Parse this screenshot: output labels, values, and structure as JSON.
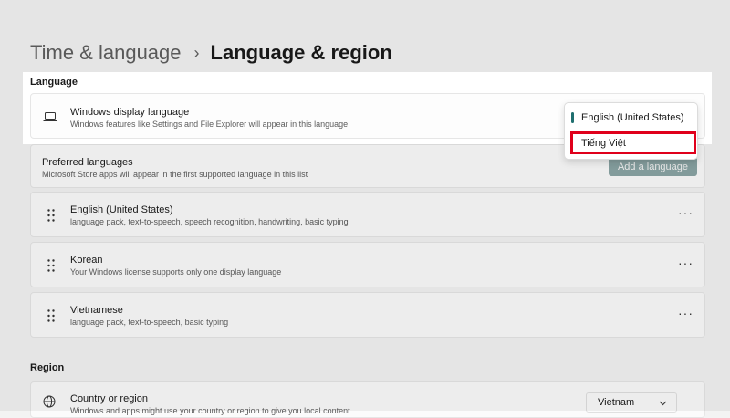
{
  "breadcrumb": {
    "parent": "Time & language",
    "separator": "›",
    "current": "Language & region"
  },
  "language_section": {
    "heading": "Language",
    "display_language": {
      "title": "Windows display language",
      "subtitle": "Windows features like Settings and File Explorer will appear in this language",
      "icon": "laptop-icon"
    },
    "dropdown_options": [
      {
        "label": "English (United States)",
        "selected": true
      },
      {
        "label": "Tiếng Việt",
        "highlighted": true
      }
    ]
  },
  "preferred_languages": {
    "title": "Preferred languages",
    "subtitle": "Microsoft Store apps will appear in the first supported language in this list",
    "add_button": "Add a language",
    "items": [
      {
        "name": "English (United States)",
        "detail": "language pack, text-to-speech, speech recognition, handwriting, basic typing",
        "more": "···"
      },
      {
        "name": "Korean",
        "detail": "Your Windows license supports only one display language",
        "more": "···"
      },
      {
        "name": "Vietnamese",
        "detail": "language pack, text-to-speech, basic typing",
        "more": "···"
      }
    ]
  },
  "region_section": {
    "heading": "Region",
    "country": {
      "title": "Country or region",
      "subtitle": "Windows and apps might use your country or region to give you local content",
      "value": "Vietnam",
      "icon": "globe-icon"
    }
  },
  "colors": {
    "accent": "#1f6f6f",
    "annotation": "#e0001b",
    "background": "#f3f3f3"
  }
}
